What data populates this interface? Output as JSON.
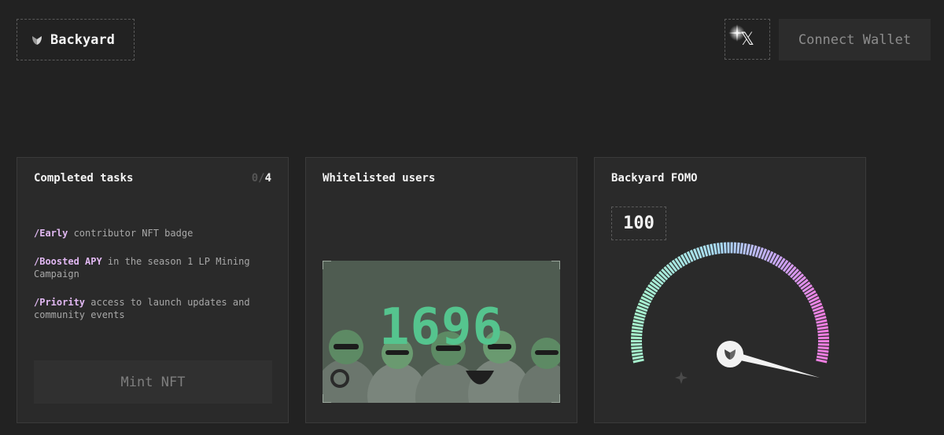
{
  "header": {
    "brand": "Backyard",
    "x_label": "𝕏",
    "connect_label": "Connect Wallet"
  },
  "tasks_card": {
    "title": "Completed tasks",
    "completed": "0",
    "separator": "/",
    "total": "4",
    "items": [
      {
        "keyword": "/Early",
        "text": " contributor NFT badge"
      },
      {
        "keyword": "/Boosted APY",
        "text": " in the season 1 LP Mining Campaign"
      },
      {
        "keyword": "/Priority",
        "text": " access to launch updates and community events"
      }
    ],
    "mint_label": "Mint NFT"
  },
  "whitelist_card": {
    "title": "Whitelisted users",
    "count": "1696"
  },
  "fomo_card": {
    "title": "Backyard FOMO",
    "value": "100",
    "gauge_level": 1.0
  },
  "colors": {
    "accent_purple": "#e1b8f2",
    "count_green": "#55c48e",
    "gauge_start": "#a6f2cc",
    "gauge_end": "#f07de0"
  },
  "icons": {
    "brand": "backyard-logo-icon",
    "gauge_knob": "backyard-logo-icon"
  }
}
